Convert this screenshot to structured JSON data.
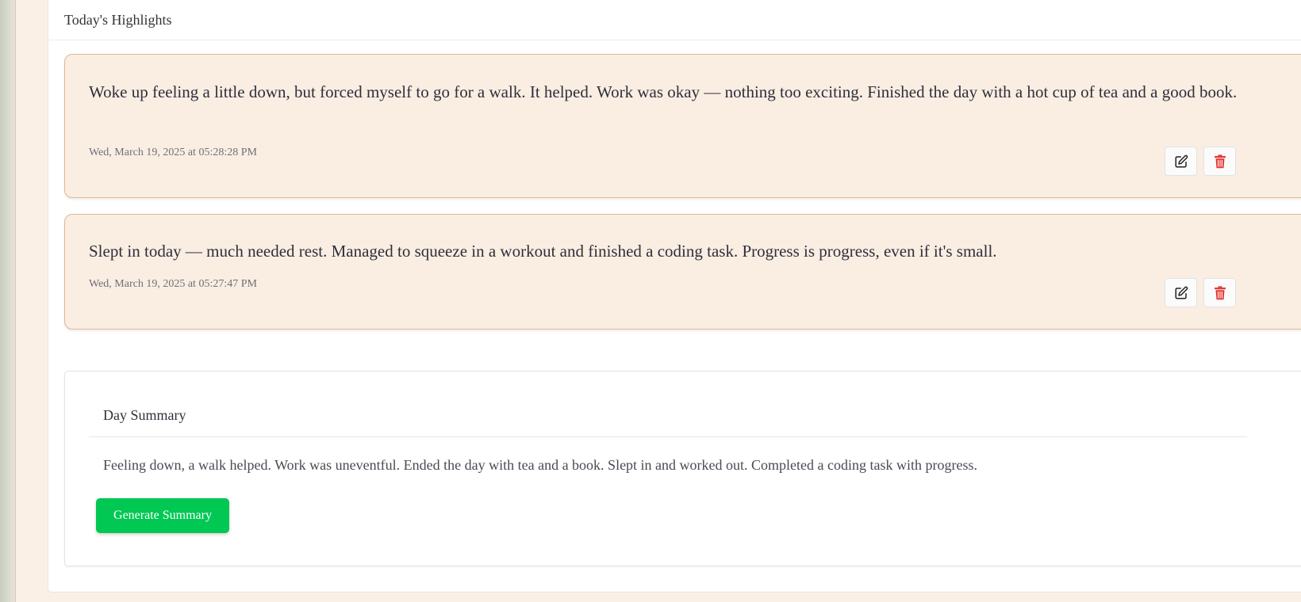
{
  "header": {
    "title": "Today's Highlights"
  },
  "entries": [
    {
      "text": "Woke up feeling a little down, but forced myself to go for a walk. It helped. Work was okay — nothing too exciting. Finished the day with a hot cup of tea and a good book.",
      "date": "Wed, March 19, 2025 at 05:28:28 PM",
      "edit_icon": "pencil-square-icon",
      "delete_icon": "trash-icon"
    },
    {
      "text": "Slept in today — much needed rest. Managed to squeeze in a workout and finished a coding task. Progress is progress, even if it's small.",
      "date": "Wed, March 19, 2025 at 05:27:47 PM",
      "edit_icon": "pencil-square-icon",
      "delete_icon": "trash-icon"
    }
  ],
  "summary": {
    "heading": "Day Summary",
    "text": "Feeling down, a walk helped. Work was uneventful. Ended the day with tea and a book. Slept in and worked out. Completed a coding task with progress.",
    "button_label": "Generate Summary"
  },
  "colors": {
    "page_background": "#faf0e6",
    "card_background": "#faeee3",
    "card_border": "#e0b894",
    "delete_icon": "#e53935",
    "generate_button": "#00c853"
  }
}
